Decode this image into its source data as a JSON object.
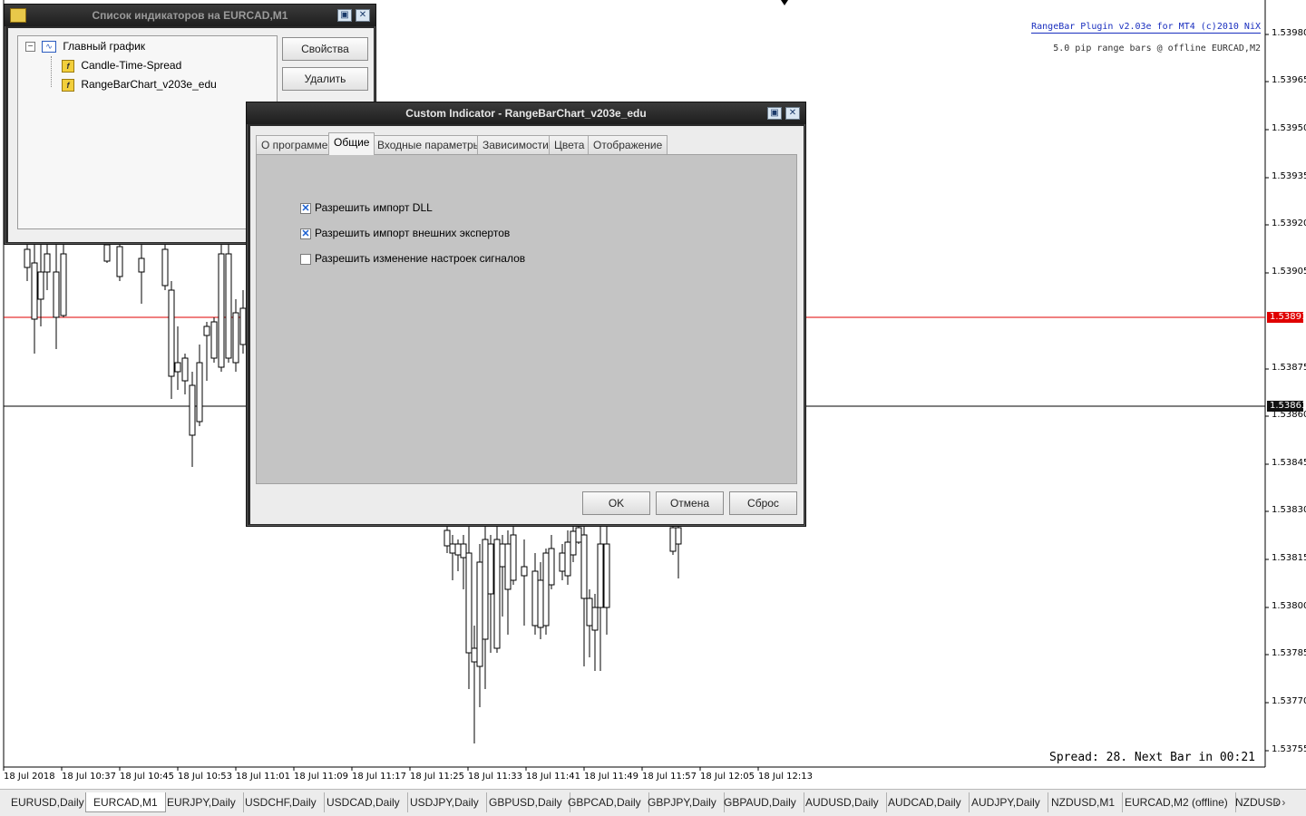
{
  "chart": {
    "symbol": "EURCAD,M1",
    "price_labels": [
      "1.53980",
      "1.53965",
      "1.53950",
      "1.53935",
      "1.53920",
      "1.53905",
      "1.53875",
      "1.53860",
      "1.53845",
      "1.53830",
      "1.53815",
      "1.53800",
      "1.53785",
      "1.53770",
      "1.53755"
    ],
    "bid_tag": "1.53891",
    "ask_tag": "1.53863",
    "bid_line_color": "#e00000",
    "ask_line_color": "#000000",
    "time_labels": [
      "18 Jul 2018",
      "18 Jul 10:37",
      "18 Jul 10:45",
      "18 Jul 10:53",
      "18 Jul 11:01",
      "18 Jul 11:09",
      "18 Jul 11:17",
      "18 Jul 11:25",
      "18 Jul 11:33",
      "18 Jul 11:41",
      "18 Jul 11:49",
      "18 Jul 11:57",
      "18 Jul 12:05",
      "18 Jul 12:13"
    ],
    "plugin_title": "RangeBar Plugin v2.03e for MT4 (c)2010 NiX",
    "plugin_subtitle": "5.0 pip range bars @ offline EURCAD,M2",
    "spread_info": "Spread: 28. Next Bar in 00:21"
  },
  "indicator_list": {
    "title": "Список индикаторов на EURCAD,M1",
    "tree_root": "Главный график",
    "items": [
      "Candle-Time-Spread",
      "RangeBarChart_v203e_edu"
    ],
    "properties_button": "Свойства",
    "delete_button": "Удалить"
  },
  "custom_indicator": {
    "title": "Custom Indicator - RangeBarChart_v203e_edu",
    "tabs": [
      "О программе",
      "Общие",
      "Входные параметры",
      "Зависимости",
      "Цвета",
      "Отображение"
    ],
    "active_tab": "Общие",
    "options": [
      {
        "label": "Разрешить импорт DLL",
        "checked": true
      },
      {
        "label": "Разрешить импорт внешних экспертов",
        "checked": true
      },
      {
        "label": "Разрешить изменение настроек сигналов",
        "checked": false
      }
    ],
    "ok_button": "OK",
    "cancel_button": "Отмена",
    "reset_button": "Сброс"
  },
  "chart_tabs": [
    "EURUSD,Daily",
    "EURCAD,M1",
    "EURJPY,Daily",
    "USDCHF,Daily",
    "USDCAD,Daily",
    "USDJPY,Daily",
    "GBPUSD,Daily",
    "GBPCAD,Daily",
    "GBPJPY,Daily",
    "GBPAUD,Daily",
    "AUDUSD,Daily",
    "AUDCAD,Daily",
    "AUDJPY,Daily",
    "NZDUSD,M1",
    "EURCAD,M2 (offline)",
    "NZDUSD"
  ],
  "active_chart_tab": "EURCAD,M1",
  "scroll_arrows": "‹ ›"
}
